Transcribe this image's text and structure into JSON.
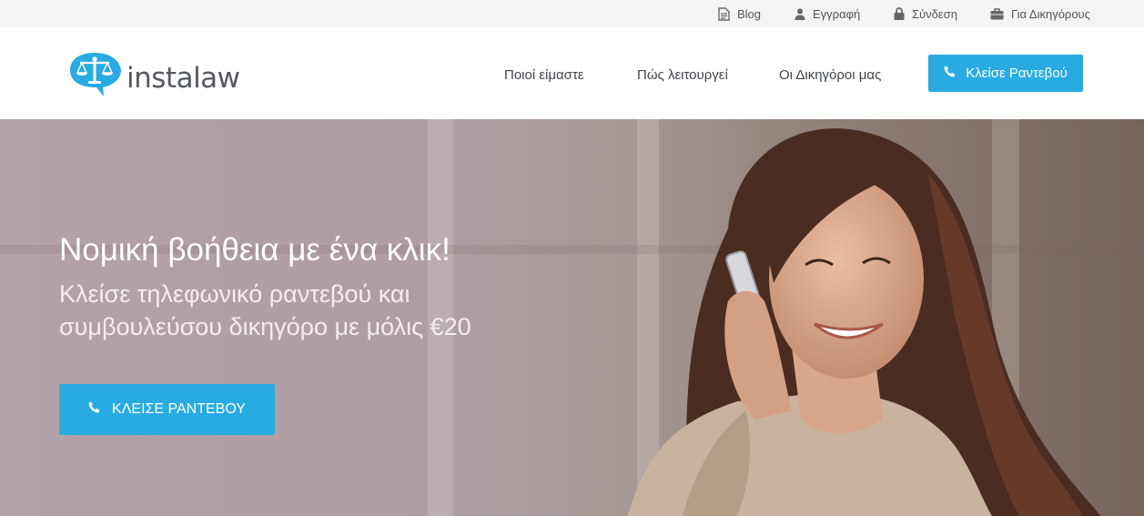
{
  "topbar": {
    "links": [
      {
        "label": "Blog",
        "icon": "document-icon"
      },
      {
        "label": "Εγγραφή",
        "icon": "user-icon"
      },
      {
        "label": "Σύνδεση",
        "icon": "lock-icon"
      },
      {
        "label": "Για Δικηγόρους",
        "icon": "briefcase-icon"
      }
    ]
  },
  "header": {
    "logo_text": "instalaw",
    "nav": [
      "Ποιοί είμαστε",
      "Πώς λειτουργεί",
      "Οι Δικηγόροι μας"
    ],
    "cta_label": "Κλείσε Ραντεβού"
  },
  "hero": {
    "title": "Νομική βοήθεια με ένα κλικ!",
    "subtitle_line1": "Κλείσε τηλεφωνικό ραντεβού και",
    "subtitle_line2": "συμβουλεύσου δικηγόρο με μόλις €20",
    "cta_label": "ΚΛΕΙΣΕ ΡΑΝΤΕΒΟΥ"
  },
  "colors": {
    "accent": "#29abe2",
    "topbar_bg": "#f4f4f4",
    "nav_text": "#3e4449"
  }
}
